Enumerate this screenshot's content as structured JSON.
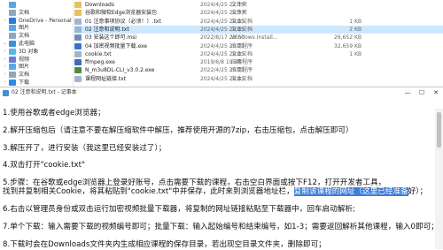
{
  "explorer": {
    "nav": [
      {
        "label": "",
        "icon": "pictures-icon",
        "color": "#5aa6e6",
        "chev": ""
      },
      {
        "label": "文档",
        "icon": "documents-icon",
        "color": "#8fa6c2",
        "chev": ""
      },
      {
        "label": "OneDrive - Personal",
        "icon": "cloud-icon",
        "color": "#2b7cd3",
        "chev": "›"
      },
      {
        "label": "图片",
        "icon": "pictures-icon",
        "color": "#5aa6e6",
        "chev": ""
      },
      {
        "label": "文档",
        "icon": "documents-icon",
        "color": "#8fa6c2",
        "chev": ""
      },
      {
        "label": "此电脑",
        "icon": "pc-icon",
        "color": "#3d8fd6",
        "chev": "⌄"
      },
      {
        "label": "3D 对象",
        "icon": "objects3d-icon",
        "color": "#56b6e8",
        "chev": "›"
      },
      {
        "label": "视频",
        "icon": "video-icon",
        "color": "#6b7bd6",
        "chev": "›"
      },
      {
        "label": "图片",
        "icon": "pictures-icon",
        "color": "#5aa6e6",
        "chev": "›"
      },
      {
        "label": "文档",
        "icon": "documents-icon",
        "color": "#8fa6c2",
        "chev": "›"
      },
      {
        "label": "下载",
        "icon": "download-icon",
        "color": "#2d8be0",
        "chev": "›"
      }
    ],
    "files": [
      {
        "name": "Downloads",
        "date": "2024/4/25 22:15",
        "type": "文件夹",
        "size": "",
        "icon": "folder-icon",
        "color": "#e8c05a"
      },
      {
        "name": "谷歌和微软Edge浏览器安装包",
        "date": "2024/4/25 20:33",
        "type": "文件夹",
        "size": "",
        "icon": "folder-icon",
        "color": "#e8c05a"
      },
      {
        "name": "01 注意事项协议（必须！）.txt",
        "date": "2024/4/25 20:25",
        "type": "文本文档",
        "size": "1 KB",
        "icon": "text-file-icon",
        "color": "#9fb4cf"
      },
      {
        "name": "02 注意和说明.txt",
        "date": "2024/4/25 20:25",
        "type": "文本文档",
        "size": "2 KB",
        "icon": "text-file-icon",
        "color": "#9fb4cf"
      },
      {
        "name": "03 安装这个即可.msi",
        "date": "2022/8/17 20:50",
        "type": "Windows Install...",
        "size": "26,652 KB",
        "icon": "installer-icon",
        "color": "#6c8fb8"
      },
      {
        "name": "04 加密视频批量下载.exe",
        "date": "2024/4/25 20:21",
        "type": "应用程序",
        "size": "32,659 KB",
        "icon": "app-icon",
        "color": "#3a72c6"
      },
      {
        "name": "cookie.txt",
        "date": "2024/4/25 20:25",
        "type": "文本文档",
        "size": "1 KB",
        "icon": "text-file-icon",
        "color": "#9fb4cf"
      },
      {
        "name": "ffmpeg.exe",
        "date": "2019/6/8 19:48",
        "type": "应用程序",
        "size": "",
        "icon": "app-icon",
        "color": "#3d6db5"
      },
      {
        "name": "N_m3u8DL-CLI_v3.0.2.exe",
        "date": "2022/4/25 20:21",
        "type": "应用程序",
        "size": "",
        "icon": "app-icon",
        "color": "#4b8a4b"
      },
      {
        "name": "课程网址链接.txt",
        "date": "2024/4/25 20:21",
        "type": "文本文档",
        "size": "",
        "icon": "text-file-icon",
        "color": "#9fb4cf"
      }
    ]
  },
  "notepad": {
    "title": "02 注意和说明.txt - 记事本",
    "min": "—",
    "max": "☐",
    "close": "✕",
    "lines": [
      "1.使用谷歌或者edge浏览器；",
      "",
      "2.解开压缩包后（请注意不要在解压缩软件中解压，推荐使用开源的7zip，右击压缩包，点击解压即可）",
      "",
      "3.解压开了，进行安装（我这里已经安装过了）；",
      "",
      "4.双击打开\"cookie.txt\"",
      "",
      "5.步骤：在谷歌或edge浏览器上登录好账号，点击需要下载的课程，右击空白界面或按下F12，打开开发者工具，",
      "找到并复制相关Cookie，将其粘贴到\"cookie.txt\"中并保存，此时来到浏览器地址栏，",
      "",
      "6.右击以管理员身份或双击运行加密视频批量下载器，将复制的网址链接粘贴至下载器中，回车启动解析;",
      "",
      "7.单个下载：输入需要下载的视频编号即可；批量下载：输入起始编号和结束编号，如1-3；需要返回解析其他课程，输入0即可；",
      "",
      "8.下载时会在Downloads文件夹内生成相应课程的保存目录，若出现空目录文件夹，删除即可；"
    ],
    "highlight": "复制该课程的网址（这里已经准备",
    "after_highlight": "好）；"
  }
}
